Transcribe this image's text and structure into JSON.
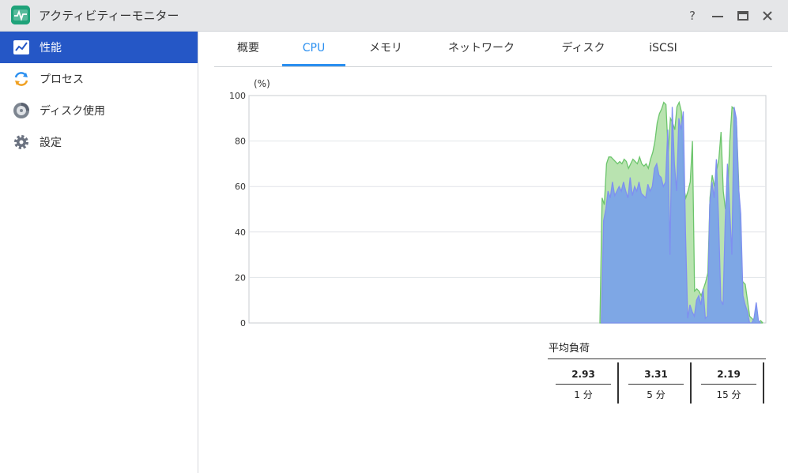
{
  "window": {
    "title": "アクティビティーモニター",
    "buttons": {
      "help": "?",
      "minimize": "—",
      "maximize": "☐",
      "close": "✕"
    }
  },
  "sidebar": {
    "items": [
      {
        "label": "性能",
        "icon": "performance-chart-icon",
        "active": true
      },
      {
        "label": "プロセス",
        "icon": "process-refresh-icon",
        "active": false
      },
      {
        "label": "ディスク使用",
        "icon": "disk-usage-icon",
        "active": false
      },
      {
        "label": "設定",
        "icon": "gear-icon",
        "active": false
      }
    ]
  },
  "tabs": [
    {
      "label": "概要",
      "active": false
    },
    {
      "label": "CPU",
      "active": true
    },
    {
      "label": "メモリ",
      "active": false
    },
    {
      "label": "ネットワーク",
      "active": false
    },
    {
      "label": "ディスク",
      "active": false
    },
    {
      "label": "iSCSI",
      "active": false
    }
  ],
  "chart_data": {
    "type": "area",
    "ylabel": "(%)",
    "ylim": [
      0,
      100
    ],
    "yticks": [
      "100",
      "80",
      "60",
      "40",
      "20",
      "0"
    ],
    "grid": true,
    "series": [
      {
        "color": "#6cc56c",
        "fill": "#b9e3b0",
        "values": [
          0,
          0,
          0,
          0,
          0,
          0,
          0,
          0,
          0,
          0,
          0,
          0,
          0,
          0,
          0,
          0,
          0,
          0,
          0,
          0,
          0,
          0,
          0,
          0,
          0,
          0,
          0,
          0,
          0,
          0,
          0,
          0,
          0,
          0,
          0,
          0,
          0,
          0,
          0,
          0,
          0,
          0,
          0,
          0,
          0,
          0,
          0,
          0,
          0,
          0,
          0,
          0,
          0,
          0,
          0,
          0,
          0,
          0,
          0,
          0,
          0,
          0,
          0,
          0,
          0,
          0,
          0,
          0,
          0,
          0,
          0,
          0,
          0,
          0,
          0,
          0,
          0,
          0,
          0,
          0,
          0,
          0,
          0,
          0,
          0,
          0,
          0,
          0,
          0,
          0,
          0,
          0,
          0,
          0,
          0,
          0,
          0,
          0,
          0,
          0,
          0,
          0,
          0,
          0,
          0,
          0,
          0,
          0,
          0,
          0,
          0,
          0,
          0,
          0,
          0,
          0,
          0,
          0,
          0,
          0,
          0,
          0,
          0,
          0,
          0,
          0,
          0,
          0,
          0,
          0,
          0,
          0,
          0,
          0,
          0,
          0,
          0,
          0,
          0,
          0,
          0,
          0,
          0,
          0,
          0,
          0,
          0,
          0,
          0,
          0,
          0,
          0,
          0,
          0,
          0,
          0,
          0,
          0,
          0,
          0,
          55,
          52,
          70,
          73,
          73,
          72,
          71,
          70,
          71,
          70,
          72,
          71,
          68,
          70,
          72,
          71,
          70,
          73,
          70,
          69,
          70,
          68,
          72,
          75,
          80,
          88,
          92,
          94,
          97,
          96,
          75,
          90,
          88,
          85,
          95,
          97,
          93,
          60,
          55,
          58,
          62,
          80,
          14,
          15,
          14,
          12,
          15,
          18,
          22,
          55,
          65,
          60,
          67,
          72,
          84,
          58,
          50,
          56,
          80,
          95,
          94,
          88,
          62,
          20,
          18,
          17,
          10,
          3,
          2,
          1,
          0,
          0,
          1,
          0,
          0
        ]
      },
      {
        "color": "#7f8ff0",
        "fill": "#7aa3e8",
        "values": [
          0,
          0,
          0,
          0,
          0,
          0,
          0,
          0,
          0,
          0,
          0,
          0,
          0,
          0,
          0,
          0,
          0,
          0,
          0,
          0,
          0,
          0,
          0,
          0,
          0,
          0,
          0,
          0,
          0,
          0,
          0,
          0,
          0,
          0,
          0,
          0,
          0,
          0,
          0,
          0,
          0,
          0,
          0,
          0,
          0,
          0,
          0,
          0,
          0,
          0,
          0,
          0,
          0,
          0,
          0,
          0,
          0,
          0,
          0,
          0,
          0,
          0,
          0,
          0,
          0,
          0,
          0,
          0,
          0,
          0,
          0,
          0,
          0,
          0,
          0,
          0,
          0,
          0,
          0,
          0,
          0,
          0,
          0,
          0,
          0,
          0,
          0,
          0,
          0,
          0,
          0,
          0,
          0,
          0,
          0,
          0,
          0,
          0,
          0,
          0,
          0,
          0,
          0,
          0,
          0,
          0,
          0,
          0,
          0,
          0,
          0,
          0,
          0,
          0,
          0,
          0,
          0,
          0,
          0,
          0,
          0,
          0,
          0,
          0,
          0,
          0,
          0,
          0,
          0,
          0,
          0,
          0,
          0,
          0,
          0,
          0,
          0,
          0,
          0,
          0,
          0,
          0,
          0,
          0,
          0,
          0,
          0,
          0,
          0,
          0,
          0,
          0,
          0,
          0,
          0,
          0,
          0,
          0,
          0,
          0,
          45,
          50,
          58,
          55,
          62,
          56,
          58,
          60,
          58,
          62,
          58,
          55,
          64,
          56,
          60,
          58,
          62,
          57,
          56,
          55,
          61,
          58,
          60,
          68,
          70,
          65,
          64,
          60,
          62,
          85,
          30,
          95,
          70,
          58,
          90,
          85,
          93,
          40,
          2,
          8,
          5,
          3,
          10,
          12,
          8,
          15,
          2,
          3,
          52,
          62,
          55,
          72,
          45,
          10,
          8,
          45,
          70,
          50,
          30,
          95,
          90,
          60,
          48,
          12,
          8,
          5,
          0,
          0,
          2,
          9,
          1,
          0,
          0,
          0
        ]
      }
    ]
  },
  "load_average": {
    "title": "平均負荷",
    "cells": [
      {
        "value": "2.93",
        "label": "1 分"
      },
      {
        "value": "3.31",
        "label": "5 分"
      },
      {
        "value": "2.19",
        "label": "15 分"
      }
    ]
  }
}
